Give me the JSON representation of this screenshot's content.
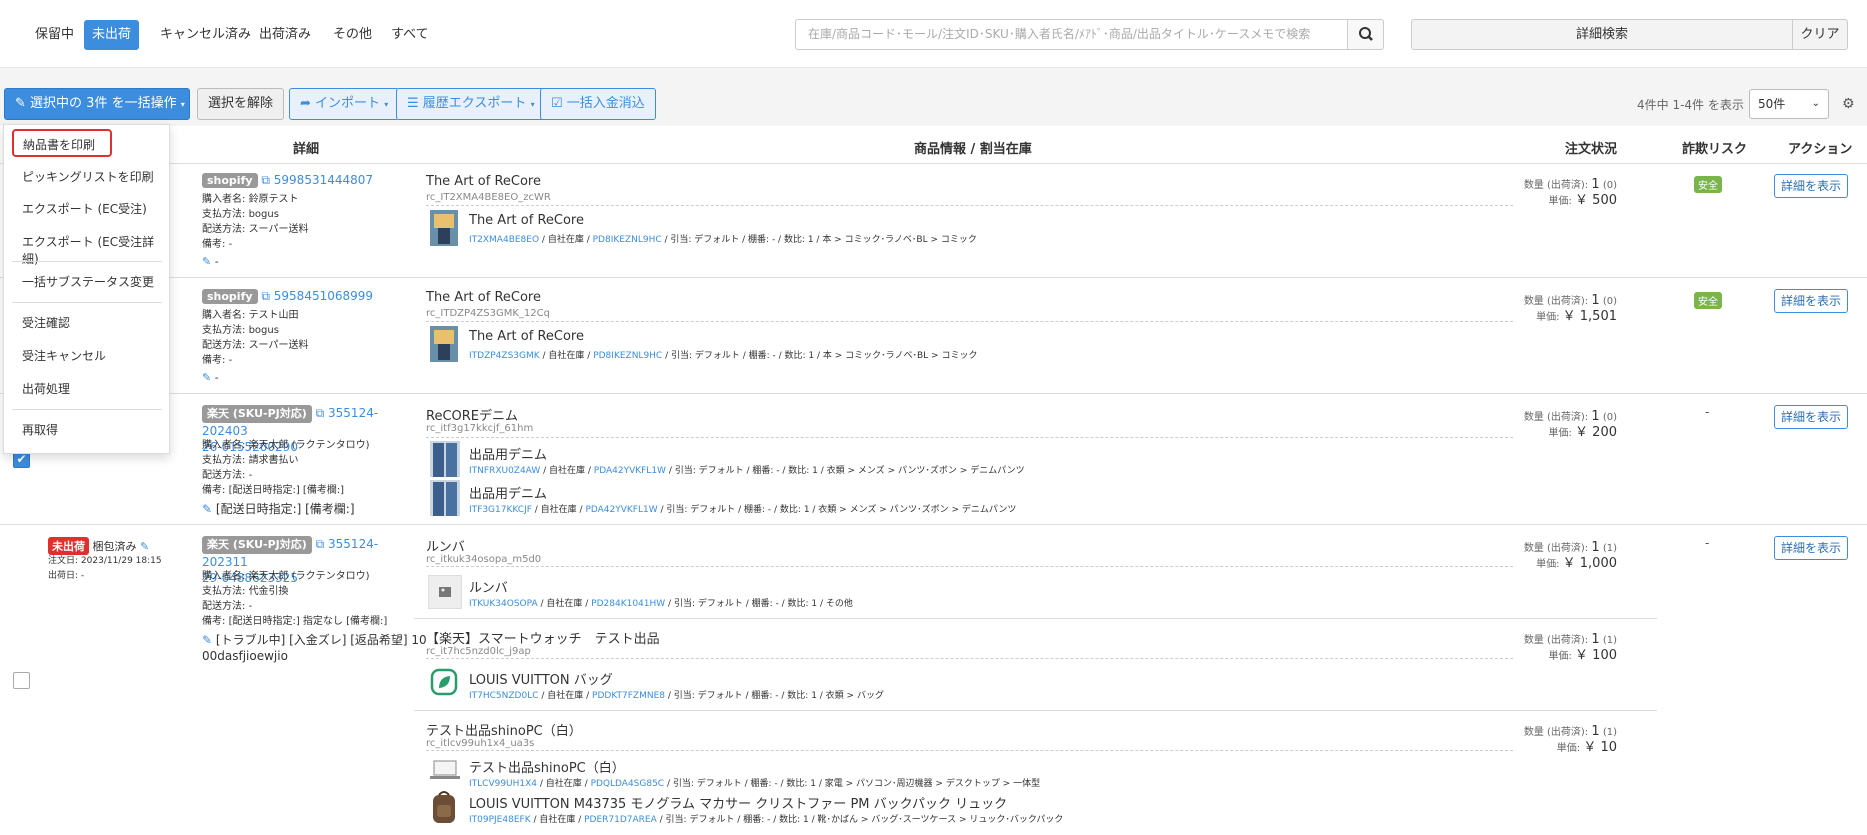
{
  "tabs": [
    "保留中",
    "未出荷",
    "キャンセル済み",
    "出荷済み",
    "その他",
    "すべて"
  ],
  "search": {
    "placeholder": "在庫/商品コード･モール/注文ID･SKU･購入者氏名/ﾒｱﾄﾞ･商品/出品タイトル･ケースメモで検索",
    "advanced": "詳細検索",
    "clear": "クリア"
  },
  "toolbar": {
    "bulk": "選択中の 3件 を一括操作",
    "deselect": "選択を解除",
    "import": "インポート",
    "export": "履歴エクスポート",
    "payment": "一括入金消込",
    "count": "4件中 1-4件 を表示",
    "per_page": "50件"
  },
  "headers": {
    "detail": "詳細",
    "product": "商品情報 / 割当在庫",
    "status": "注文状況",
    "fraud": "詐欺リスク",
    "action": "アクション"
  },
  "dropdown": [
    "納品書を印刷",
    "ピッキングリストを印刷",
    "エクスポート (EC受注)",
    "エクスポート (EC受注詳細)",
    "一括サブステータス変更",
    "受注確認",
    "受注キャンセル",
    "出荷処理",
    "再取得"
  ],
  "labels": {
    "buyer": "購入者名:",
    "pay": "支払方法:",
    "ship": "配送方法:",
    "note": "備考:",
    "qty": "数量 (出荷済):",
    "price": "単価:",
    "detail_btn": "詳細を表示",
    "safe": "安全",
    "order_date": "注文日:",
    "ship_date": "出荷日:"
  },
  "orders": [
    {
      "mall": "shopify",
      "id": "5998531444807",
      "buyer": "鈴原テスト",
      "pay": "bogus",
      "ship": "スーパー送料",
      "note": "-",
      "memo": "-",
      "product": "The Art of ReCore",
      "sku": "rc_IT2XMA4BE8EO_zcWR",
      "item": "The Art of ReCore",
      "code": "IT2XMA4BE8EO",
      "meta1": "自社在庫",
      "pcode": "PD8IKEZNL9HC",
      "meta2": "引当: デフォルト / 棚番: - / 数比: 1 / 本 > コミック･ラノベ･BL > コミック",
      "qty": "1",
      "shipped": "(0)",
      "price": "￥ 500",
      "risk": "安全"
    },
    {
      "mall": "shopify",
      "id": "5958451068999",
      "buyer": "テスト山田",
      "pay": "bogus",
      "ship": "スーパー送料",
      "note": "-",
      "memo": "-",
      "product": "The Art of ReCore",
      "sku": "rc_ITDZP4ZS3GMK_12Cq",
      "item": "The Art of ReCore",
      "code": "ITDZP4ZS3GMK",
      "meta1": "自社在庫",
      "pcode": "PD8IKEZNL9HC",
      "meta2": "引当: デフォルト / 棚番: - / 数比: 1 / 本 > コミック･ラノベ･BL > コミック",
      "qty": "1",
      "shipped": "(0)",
      "price": "￥ 1,501",
      "risk": "安全"
    },
    {
      "mall": "楽天 (SKU-PJ対応)",
      "id1": "355124-202403",
      "id2": "26-0155200290",
      "buyer": "楽天太郎 (ラクテンタロウ)",
      "pay": "請求書払い",
      "ship": "-",
      "note": "[配送日時指定:] [備考欄:]",
      "memo": "[配送日時指定:] [備考欄:]",
      "product": "ReCOREデニム",
      "sku": "rc_itf3g17kkcjf_61hm",
      "items": [
        {
          "name": "出品用デニム",
          "code": "ITNFRXU0Z4AW",
          "pcode": "PDA42YVKFL1W",
          "meta": "引当: デフォルト / 棚番: - / 数比: 1 / 衣類 > メンズ > パンツ･ズボン > デニムパンツ"
        },
        {
          "name": "出品用デニム",
          "code": "ITF3G17KKCJF",
          "pcode": "PDA42YVKFL1W",
          "meta": "引当: デフォルト / 棚番: - / 数比: 1 / 衣類 > メンズ > パンツ･ズボン > デニムパンツ"
        }
      ],
      "qty": "1",
      "shipped": "(0)",
      "price": "￥ 200",
      "risk": "-"
    },
    {
      "status": "未出荷",
      "status2": "梱包済み",
      "order_date": "2023/11/29 18:15",
      "ship_date": "-",
      "mall": "楽天 (SKU-PJ対応)",
      "id1": "355124-202311",
      "id2": "29-0488623325",
      "buyer": "楽天太郎 (ラクテンタロウ)",
      "pay": "代金引換",
      "ship": "-",
      "note": "[配送日時指定:] 指定なし [備考欄:]",
      "memo1": "[トラブル中] [入金ズレ] [返品希望] 10",
      "memo2": "00dasfjioewjio",
      "products": [
        {
          "name": "ルンバ",
          "sku": "rc_itkuk34osopa_m5d0",
          "item": "ルンバ",
          "code": "ITKUK34OSOPA",
          "pcode": "PD284K1041HW",
          "meta": "引当: デフォルト / 棚番: - / 数比: 1 / その他",
          "qty": "1",
          "shipped": "(1)",
          "price": "￥ 1,000"
        },
        {
          "name": "【楽天】スマートウォッチ　テスト出品",
          "sku": "rc_it7hc5nzd0lc_j9ap",
          "item": "LOUIS VUITTON バッグ",
          "code": "IT7HC5NZD0LC",
          "pcode": "PDDKT7FZMNE8",
          "meta": "引当: デフォルト / 棚番: - / 数比: 1 / 衣類 > バッグ",
          "qty": "1",
          "shipped": "(1)",
          "price": "￥ 100"
        },
        {
          "name": "テスト出品shinoPC（白）",
          "sku": "rc_itlcv99uh1x4_ua3s",
          "item": "テスト出品shinoPC（白）",
          "code": "ITLCV99UH1X4",
          "pcode": "PDQLDA4SG85C",
          "meta": "引当: デフォルト / 棚番: - / 数比: 1 / 家電 > パソコン･周辺機器 > デスクトップ > 一体型",
          "item2": "LOUIS VUITTON M43735 モノグラム マカサー クリストファー PM バックパック リュック",
          "code2": "IT09PJE48EFK",
          "pcode2": "PDER71D7AREA",
          "meta2": "引当: デフォルト / 棚番: - / 数比: 1 / 靴･かばん > バッグ･スーツケース > リュック･バックパック",
          "qty": "1",
          "shipped": "(1)",
          "price": "￥ 10"
        }
      ],
      "risk": "-"
    }
  ],
  "colors": {
    "primary": "#3c8dde",
    "danger": "#e0302e",
    "safe": "#7ab54b"
  }
}
